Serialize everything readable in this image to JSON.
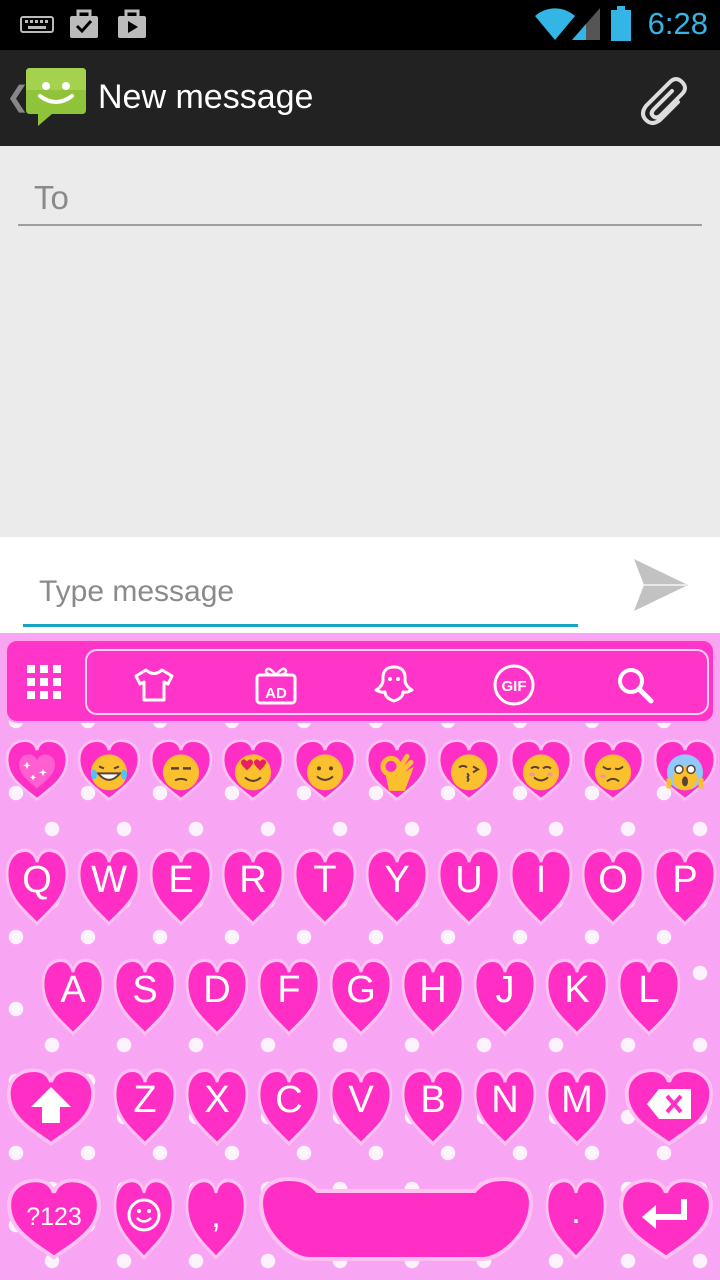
{
  "status_bar": {
    "time": "6:28"
  },
  "action_bar": {
    "title": "New message"
  },
  "compose": {
    "to_placeholder": "To",
    "message_placeholder": "Type message"
  },
  "keyboard": {
    "toolbar_icons": [
      "grid-icon",
      "theme-shirt-icon",
      "ad-gift-icon",
      "ghost-icon",
      "gif-icon",
      "search-icon"
    ],
    "gif_label": "GIF",
    "ad_label": "AD",
    "emoji_row": [
      "sparkle-heart",
      "grin-tears",
      "unamused",
      "heart-eyes",
      "smile",
      "ok-hand",
      "kiss",
      "blush",
      "disappointed",
      "scream"
    ],
    "row1": [
      "Q",
      "W",
      "E",
      "R",
      "T",
      "Y",
      "U",
      "I",
      "O",
      "P"
    ],
    "row2": [
      "A",
      "S",
      "D",
      "F",
      "G",
      "H",
      "J",
      "K",
      "L"
    ],
    "row3": [
      "Z",
      "X",
      "C",
      "V",
      "B",
      "N",
      "M"
    ],
    "row4": {
      "symbols": "?123",
      "comma": ",",
      "period": "."
    },
    "colors": {
      "key": "#ff2fc6",
      "key_border": "#ffc0f2",
      "background": "#f8a6f3"
    }
  }
}
